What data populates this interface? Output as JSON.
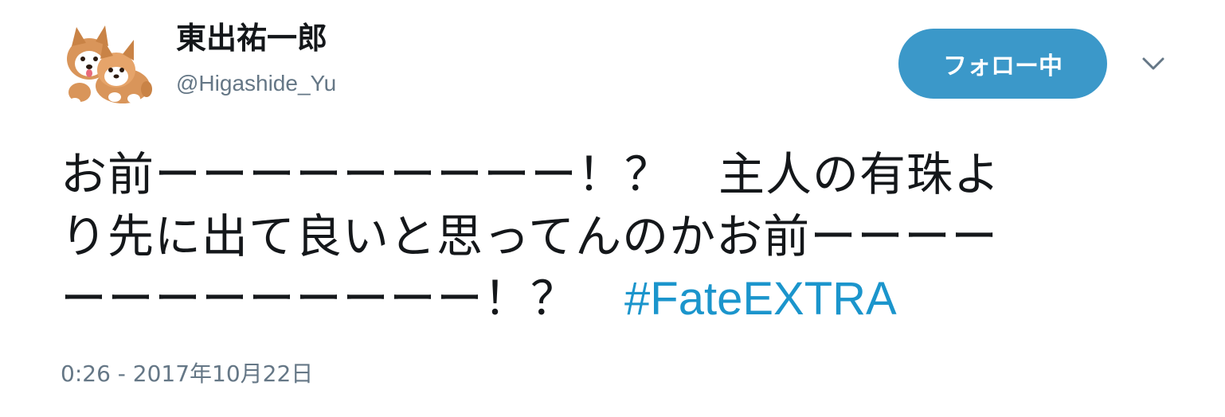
{
  "author": {
    "display_name": "東出祐一郎",
    "username": "@Higashide_Yu",
    "avatar_icon": "corgi-puppies-avatar"
  },
  "follow_button": {
    "label": "フォロー中"
  },
  "menu": {
    "icon": "chevron-down-icon"
  },
  "tweet": {
    "line1": "お前ーーーーーーーーー！？　主人の有珠よ",
    "line2": "り先に出て良いと思ってんのかお前ーーーー",
    "line3": "ーーーーーーーーー！？　",
    "hashtag": "#FateEXTRA"
  },
  "timestamp": "0:26 - 2017年10月22日",
  "colors": {
    "follow_button_bg": "#3b98c9",
    "hashtag": "#1b95cc",
    "secondary_text": "#657786",
    "primary_text": "#14171a"
  }
}
